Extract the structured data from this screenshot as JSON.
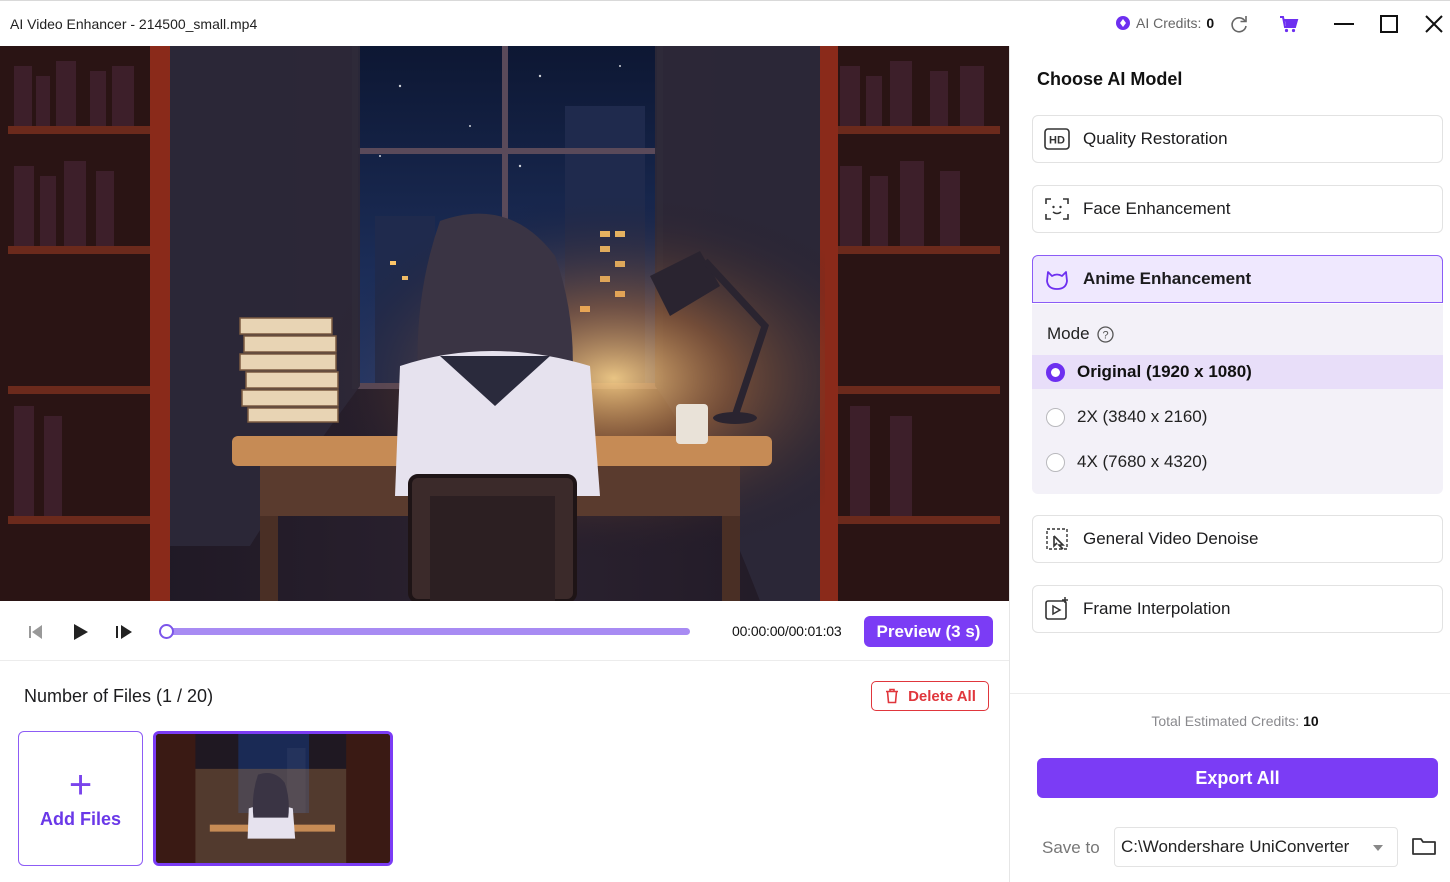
{
  "window": {
    "title": "AI Video Enhancer - 214500_small.mp4",
    "credits_label": "AI Credits:",
    "credits_value": "0",
    "accent": "#7b3cf5"
  },
  "player": {
    "timecode": "00:00:00/00:01:03",
    "preview_label": "Preview (3 s)",
    "progress": 0.0
  },
  "files": {
    "title": "Number of Files (1 / 20)",
    "delete_label": "Delete All",
    "add_label": "Add Files",
    "add_symbol": "+"
  },
  "panel": {
    "title": "Choose AI Model",
    "models": [
      {
        "label": "Quality Restoration",
        "icon": "hd-icon",
        "active": false
      },
      {
        "label": "Face Enhancement",
        "icon": "face-scan-icon",
        "active": false
      },
      {
        "label": "Anime Enhancement",
        "icon": "anime-icon",
        "active": true
      },
      {
        "label": "General Video Denoise",
        "icon": "denoise-icon",
        "active": false
      },
      {
        "label": "Frame Interpolation",
        "icon": "frame-interpolation-icon",
        "active": false
      }
    ],
    "mode_label": "Mode",
    "mode_options": [
      {
        "label": "Original (1920 x 1080)",
        "selected": true
      },
      {
        "label": "2X (3840 x 2160)",
        "selected": false
      },
      {
        "label": "4X (7680 x 4320)",
        "selected": false
      }
    ],
    "total_label": "Total Estimated Credits:",
    "total_value": "10",
    "export_label": "Export All",
    "save_label": "Save to",
    "save_path": "C:\\Wondershare UniConverter"
  }
}
